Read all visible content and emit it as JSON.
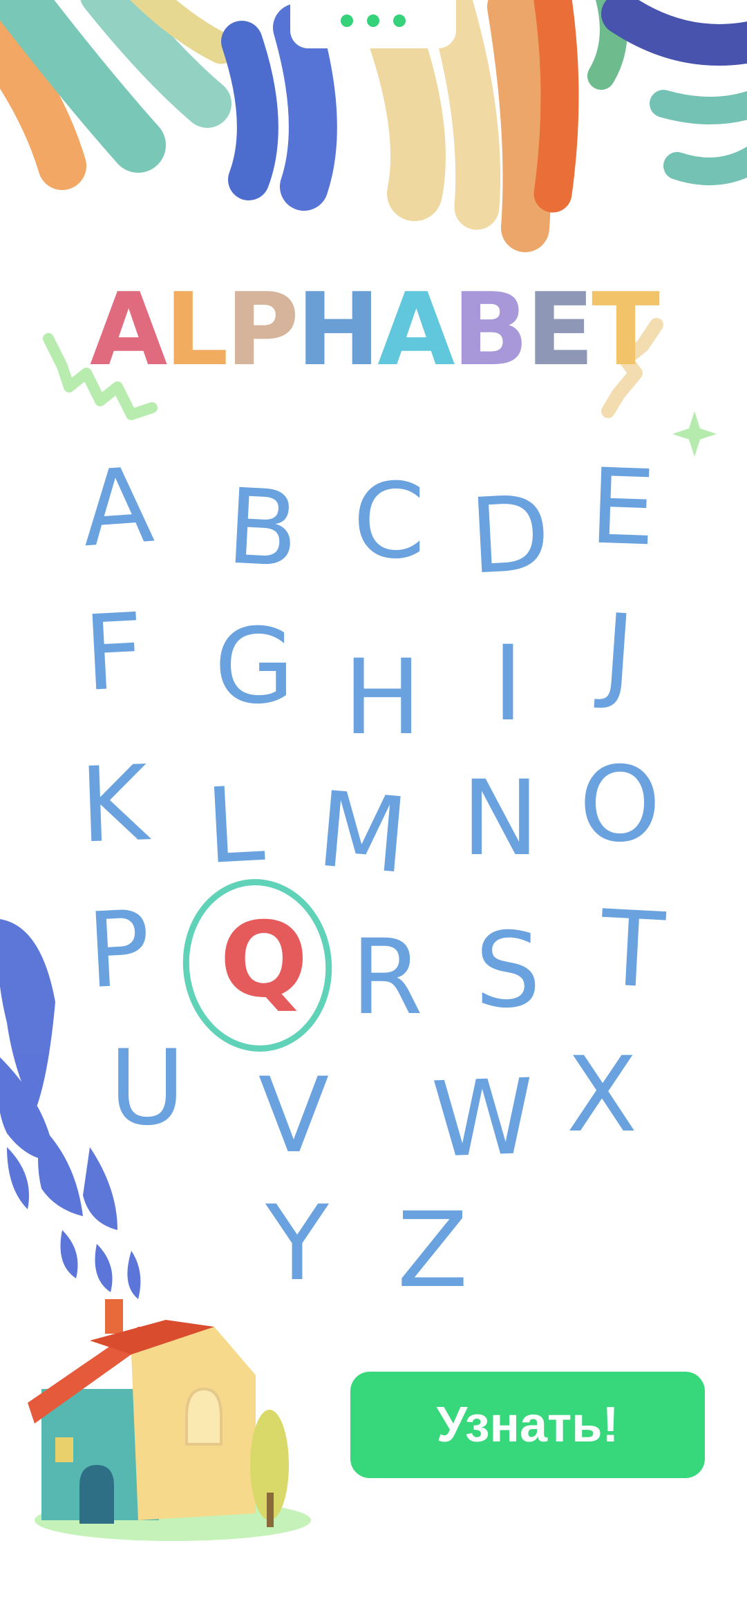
{
  "title": {
    "letters": [
      {
        "char": "A",
        "color": "#e06a7e"
      },
      {
        "char": "L",
        "color": "#f1ac5f"
      },
      {
        "char": "P",
        "color": "#d5b49b"
      },
      {
        "char": "H",
        "color": "#6a9fd6"
      },
      {
        "char": "A",
        "color": "#61c7dc"
      },
      {
        "char": "B",
        "color": "#a998d9"
      },
      {
        "char": "E",
        "color": "#8e97b5"
      },
      {
        "char": "T",
        "color": "#f3c36a"
      }
    ]
  },
  "alphabet": {
    "letters": [
      "A",
      "B",
      "C",
      "D",
      "E",
      "F",
      "G",
      "H",
      "I",
      "J",
      "K",
      "L",
      "M",
      "N",
      "O",
      "P",
      "Q",
      "R",
      "S",
      "T",
      "U",
      "V",
      "W",
      "X",
      "Y",
      "Z"
    ],
    "letter_color": "#6aa2e0",
    "highlighted_letter": "Q",
    "highlight_color": "#e55a5a",
    "ring_color": "#5fd2b8"
  },
  "cta": {
    "label": "Узнать!",
    "color": "#37d77c"
  },
  "header": {
    "dots_color": "#35d27a"
  },
  "icons": [
    "crayon-strokes-decoration",
    "squiggle-decoration",
    "sparkle-decoration",
    "smoke-plume-decoration",
    "house-illustration"
  ]
}
